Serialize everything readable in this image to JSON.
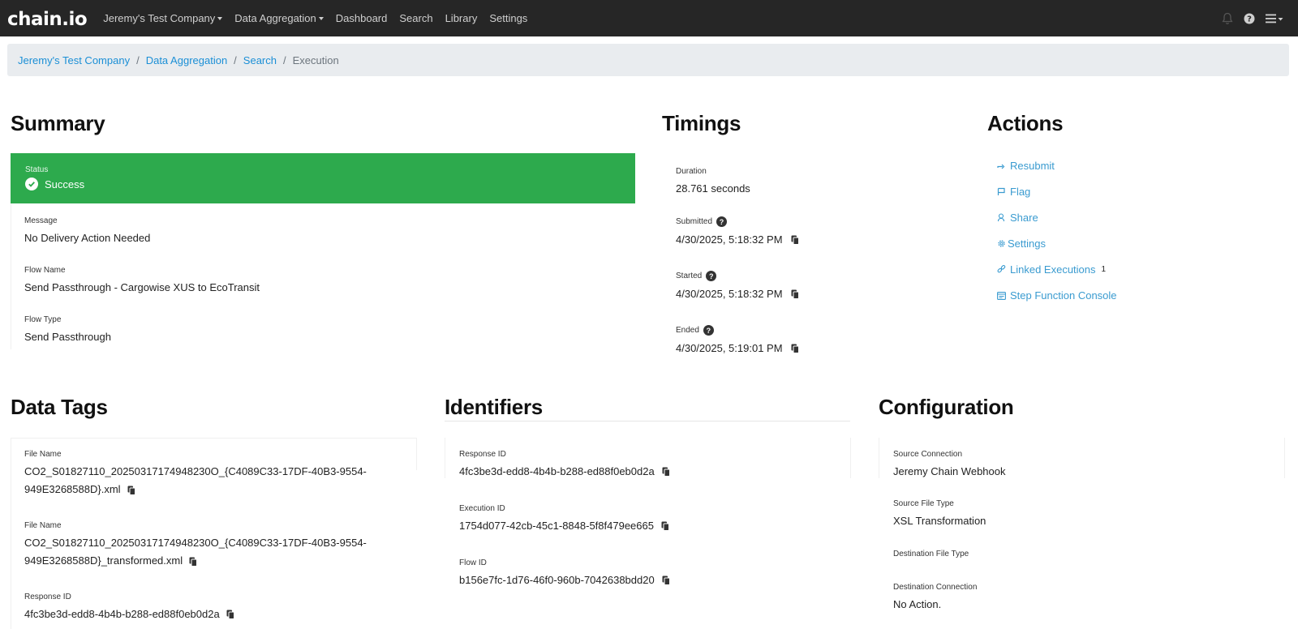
{
  "navbar": {
    "logo": "chain.io",
    "items": [
      {
        "label": "Jeremy's Test Company",
        "dropdown": true
      },
      {
        "label": "Data Aggregation",
        "dropdown": true
      },
      {
        "label": "Dashboard"
      },
      {
        "label": "Search"
      },
      {
        "label": "Library"
      },
      {
        "label": "Settings"
      }
    ],
    "right_icons": [
      "bell-icon",
      "help-icon",
      "menu-icon"
    ]
  },
  "breadcrumb": {
    "links": [
      "Jeremy's Test Company",
      "Data Aggregation",
      "Search"
    ],
    "current": "Execution",
    "separator": "/"
  },
  "summary": {
    "title": "Summary",
    "status_label": "Status",
    "status_value": "Success",
    "status_color": "#2daa4d",
    "message_label": "Message",
    "message_value": "No Delivery Action Needed",
    "flow_name_label": "Flow Name",
    "flow_name_value": "Send Passthrough - Cargowise XUS to EcoTransit",
    "flow_type_label": "Flow Type",
    "flow_type_value": "Send Passthrough"
  },
  "timings": {
    "title": "Timings",
    "duration_label": "Duration",
    "duration_value": "28.761 seconds",
    "submitted_label": "Submitted",
    "submitted_value": "4/30/2025, 5:18:32 PM",
    "started_label": "Started",
    "started_value": "4/30/2025, 5:18:32 PM",
    "ended_label": "Ended",
    "ended_value": "4/30/2025, 5:19:01 PM"
  },
  "actions": {
    "title": "Actions",
    "items": [
      {
        "label": "Resubmit",
        "icon": "resubmit-icon"
      },
      {
        "label": "Flag",
        "icon": "flag-icon"
      },
      {
        "label": "Share",
        "icon": "share-icon"
      },
      {
        "label": "Settings",
        "icon": "gear-icon"
      },
      {
        "label": "Linked Executions",
        "icon": "link-icon",
        "count": "1"
      },
      {
        "label": "Step Function Console",
        "icon": "console-icon"
      }
    ],
    "link_color": "#3a9bd0"
  },
  "data_tags": {
    "title": "Data Tags",
    "tags": [
      {
        "label": "File Name",
        "value_line1": "CO2_S01827110_20250317174948230O_{C4089C33-17DF-40B3-9554-",
        "value_line2": "949E3268588D}.xml"
      },
      {
        "label": "File Name",
        "value_line1": "CO2_S01827110_20250317174948230O_{C4089C33-17DF-40B3-9554-",
        "value_line2": "949E3268588D}_transformed.xml"
      },
      {
        "label": "Response ID",
        "value_line1": "4fc3be3d-edd8-4b4b-b288-ed88f0eb0d2a"
      }
    ]
  },
  "identifiers": {
    "title": "Identifiers",
    "response_id_label": "Response ID",
    "response_id_value": "4fc3be3d-edd8-4b4b-b288-ed88f0eb0d2a",
    "execution_id_label": "Execution ID",
    "execution_id_value": "1754d077-42cb-45c1-8848-5f8f479ee665",
    "flow_id_label": "Flow ID",
    "flow_id_value": "b156e7fc-1d76-46f0-960b-7042638bdd20"
  },
  "configuration": {
    "title": "Configuration",
    "source_connection_label": "Source Connection",
    "source_connection_value": "Jeremy Chain Webhook",
    "source_file_type_label": "Source File Type",
    "source_file_type_value": "XSL Transformation",
    "destination_file_type_label": "Destination File Type",
    "destination_file_type_value": "",
    "destination_connection_label": "Destination Connection",
    "destination_connection_value": "No Action."
  }
}
